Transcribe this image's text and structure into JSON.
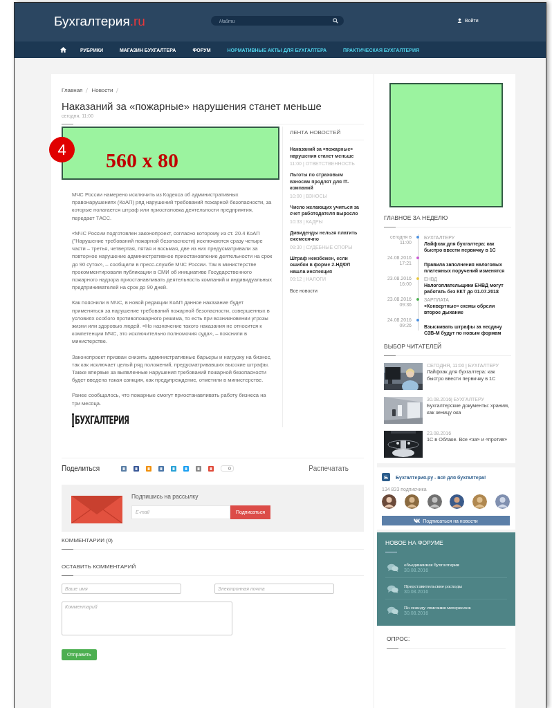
{
  "header": {
    "logo": {
      "name": "Бухгалтерия",
      "tld": ".ru"
    },
    "search": {
      "placeholder": "Найти"
    },
    "login": "Войти"
  },
  "nav": {
    "items": [
      {
        "label": "РУБРИКИ",
        "accent": false
      },
      {
        "label": "МАГАЗИН БУХГАЛТЕРА",
        "accent": false
      },
      {
        "label": "ФОРУМ",
        "accent": false
      },
      {
        "label": "НОРМАТИВНЫЕ АКТЫ ДЛЯ БУХГАЛТЕРА",
        "accent": true
      },
      {
        "label": "ПРАКТИЧЕСКАЯ БУХГАЛТЕРИЯ",
        "accent": true
      }
    ]
  },
  "breadcrumbs": [
    "Главная",
    "Новости"
  ],
  "article": {
    "title": "Наказаний за «пожарные» нарушения станет меньше",
    "date": "сегодня, 11:00",
    "ad": {
      "label": "560 x 80",
      "marker": "4"
    },
    "paragraphs": [
      "МЧС России намерено исключить из Кодекса об административных правонарушениях (КоАП) ряд нарушений требований пожарной безопасности, за которые полагается штраф или приостановка деятельности предприятия, передает ТАСС.",
      "«МЧС России подготовлен законопроект, согласно которому из ст. 20.4 КоАП (\"Нарушение требований пожарной безопасности) исключаются сразу четыре части – третья, четвертая, пятая и восьмая, две из них предусматривали за повторное нарушение административное приостановление деятельности на срок до 90 суток», – сообщили в пресс-службе МЧС России. Так в министерстве прокомментировали публикации в СМИ об инициативе Государственного пожарного надзора приостанавливать деятельность компаний и индивидуальных предпринимателей на срок до 90 дней.",
      "Как пояснили в МЧС, в новой редакции КоАП данное наказание будет применяться за нарушение требований пожарной безопасности, совершенных в условиях особого противопожарного режима, то есть при возникновении угрозы жизни или здоровью людей. «Но назначение такого наказания не относится к компетенции МЧС, это исключительно полномочия суда», – пояснили в министерстве.",
      "Законопроект призван снизить административные барьеры и нагрузку на бизнес, так как исключает целый ряд положений, предусматривавших высокие штрафы. Также впервые за выявленные нарушения требований пожарной безопасности будет введена такая санкция, как предупреждение, отметили в министерстве.",
      "Ранее сообщалось, что пожарные смогут приостанавливать работу бизнеса на три месяца."
    ],
    "source_logo": "БУХГАЛТЕРИЯ"
  },
  "news_feed": {
    "title": "ЛЕНТА НОВОСТЕЙ",
    "items": [
      {
        "title": "Наказаний за «пожарные» нарушения станет меньше",
        "meta": "11:00 | ОТВЕТСТВЕННОСТЬ"
      },
      {
        "title": "Льготы по страховым взносам продлят для IT-компаний",
        "meta": "10:00 | ВЗНОСЫ"
      },
      {
        "title": "Число желающих учиться за счет работодателя выросло",
        "meta": "10:33 | КАДРЫ"
      },
      {
        "title": "Дивиденды нельзя платить ежемесячно",
        "meta": "09:30 | СУДЕБНЫЕ СПОРЫ"
      },
      {
        "title": "Штраф неизбежен, если ошибки в форме 2-НДФЛ нашла инспекция",
        "meta": "09:12 | НАЛОГИ"
      }
    ],
    "all_link": "Все новости"
  },
  "share": {
    "label": "Поделиться",
    "icons": [
      {
        "color": "#5b7fa6"
      },
      {
        "color": "#3b5998"
      },
      {
        "color": "#f0900c"
      },
      {
        "color": "#4a76a8"
      },
      {
        "color": "#2aa2d6"
      },
      {
        "color": "#1da1f2"
      },
      {
        "color": "#8a8a8a"
      },
      {
        "color": "#e04a3a"
      }
    ],
    "count": "0",
    "print": "Распечатать"
  },
  "newsletter": {
    "title": "Подпишись на рассылку",
    "placeholder": "E-mail",
    "button": "Подписаться"
  },
  "comments": {
    "title": "КОММЕНТАРИИ (0)"
  },
  "comment_form": {
    "title": "ОСТАВИТЬ КОММЕНТАРИЙ",
    "name_placeholder": "Ваше имя",
    "email_placeholder": "Электронная почта",
    "comment_placeholder": "Комментарий",
    "submit": "Отправить"
  },
  "sidebar": {
    "ad_placeholder": true,
    "week": {
      "title": "ГЛАВНОЕ ЗА НЕДЕЛЮ",
      "items": [
        {
          "date": "сегодня в",
          "time": "11:00",
          "category": "БУХГАЛТЕРУ",
          "title": "Лайфхак для бухгалтера: как быстро ввести первичку в 1С",
          "color": "#4a90e2"
        },
        {
          "date": "24.08.2016",
          "time": "17:21",
          "title": "Правила заполнения налоговых платежных поручений изменятся",
          "color": "#c85ad0"
        },
        {
          "date": "23.08.2016",
          "time": "16:00",
          "category": "ЕНВД",
          "title": "Налогоплательщики ЕНВД могут работать без ККТ до 01.07.2018",
          "color": "#e8c840"
        },
        {
          "date": "23.08.2016",
          "time": "09:36",
          "category": "ЗАРПЛАТА",
          "title": "«Конвертные» схемы обрели второе дыхание",
          "color": "#4caf50"
        },
        {
          "date": "24.08.2016",
          "time": "09:26",
          "title": "Взыскивать штрафы за несдачу СЗВ-М будут по новым формам",
          "color": "#4a90e2"
        }
      ]
    },
    "readers": {
      "title": "ВЫБОР ЧИТАТЕЛЕЙ",
      "items": [
        {
          "kind": "office",
          "meta": "СЕГОДНЯ, 11:00 | БУХГАЛТЕРУ",
          "title": "Лайфхак для бухгалтера: как быстро ввести первичку в 1С"
        },
        {
          "kind": "corridor",
          "meta": "30.08.2016| БУХГАЛТЕРУ",
          "title": "Бухгалтерские документы: храним, как зеницу ока"
        },
        {
          "kind": "hands",
          "meta": "23.08.2016",
          "title": "1С в Облаке. Все «за» и «против»"
        }
      ]
    },
    "vk": {
      "logo_letter": "Б",
      "name": "Бухгалтерия.ру - всё для бухгалтера!",
      "subscribers": "134 833 подписчика",
      "button": "Подписаться на новости"
    },
    "forum": {
      "title": "НОВОЕ НА ФОРУМЕ",
      "items": [
        {
          "title": "объединенная бухгалтерия",
          "date": "30.08.2016"
        },
        {
          "title": "Представительские расходы",
          "date": "30.08.2016"
        },
        {
          "title": "По поводу списания материалов",
          "date": "30.08.2016"
        }
      ]
    },
    "poll": {
      "title": "ОПРОС:"
    }
  }
}
